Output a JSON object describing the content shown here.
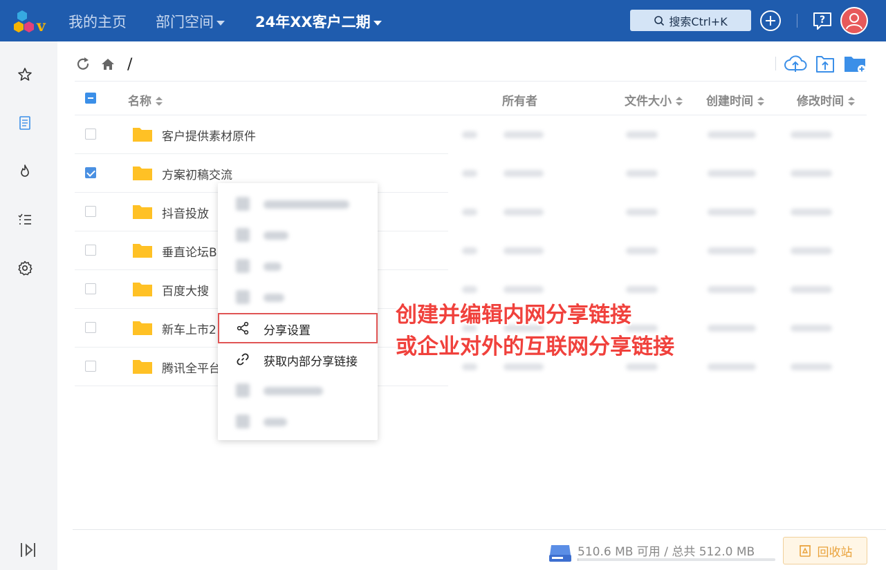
{
  "topbar": {
    "nav_home": "我的主页",
    "nav_dept": "部门空间",
    "nav_project": "24年XX客户二期",
    "search_label": "搜索Ctrl+K"
  },
  "breadcrumb": {
    "path": "/"
  },
  "table": {
    "columns": [
      "名称",
      "所有者",
      "文件大小",
      "创建时间",
      "修改时间"
    ],
    "rows": [
      {
        "name": "客户提供素材原件",
        "checked": false
      },
      {
        "name": "方案初稿交流",
        "checked": true
      },
      {
        "name": "抖音投放",
        "checked": false
      },
      {
        "name": "垂直论坛B",
        "checked": false
      },
      {
        "name": "百度大搜",
        "checked": false
      },
      {
        "name": "新车上市2",
        "checked": false
      },
      {
        "name": "腾讯全平台",
        "checked": false
      }
    ]
  },
  "context_menu": {
    "share_settings": "分享设置",
    "get_internal_link": "获取内部分享链接"
  },
  "callout": {
    "line1": "创建并编辑内网分享链接",
    "line2": "或企业对外的互联网分享链接"
  },
  "footer": {
    "storage": "510.6 MB 可用 / 总共 512.0 MB",
    "storage_used_fraction": 0.003,
    "recycle_label": "回收站"
  },
  "colors": {
    "topbar": "#1f5cae",
    "accent": "#4a90e2",
    "highlight": "#e05454",
    "folder": "#ffc125"
  }
}
